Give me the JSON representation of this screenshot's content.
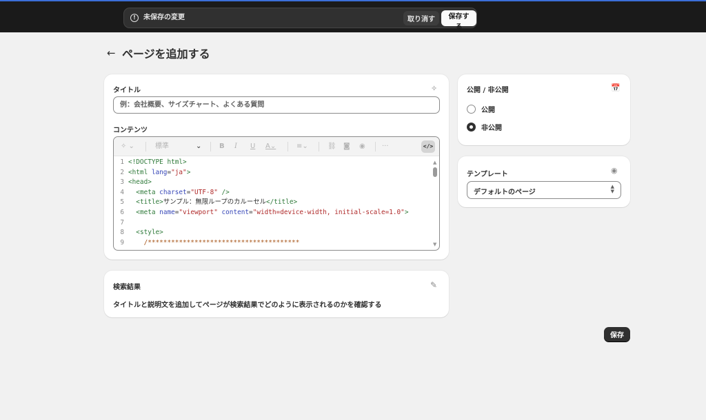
{
  "context_bar": {
    "message": "未保存の変更",
    "discard_label": "取り消す",
    "save_label": "保存する"
  },
  "header": {
    "back_icon": "←",
    "title": "ページを追加する"
  },
  "title_field": {
    "label": "タイトル",
    "placeholder": "例：会社概要、サイズチャート、よくある質問",
    "value": ""
  },
  "content": {
    "label": "コンテンツ",
    "toolbar": {
      "style_select": "標準",
      "code_toggle": "</>"
    },
    "code_lines": [
      {
        "n": "1",
        "parts": [
          {
            "c": "tag",
            "t": "<!DOCTYPE html>"
          }
        ]
      },
      {
        "n": "2",
        "parts": [
          {
            "c": "tag",
            "t": "<html "
          },
          {
            "c": "attr",
            "t": "lang"
          },
          {
            "c": "txt",
            "t": "="
          },
          {
            "c": "str",
            "t": "\"ja\""
          },
          {
            "c": "tag",
            "t": ">"
          }
        ]
      },
      {
        "n": "3",
        "parts": [
          {
            "c": "tag",
            "t": "<head>"
          }
        ]
      },
      {
        "n": "4",
        "parts": [
          {
            "c": "txt",
            "t": "  "
          },
          {
            "c": "tag",
            "t": "<meta "
          },
          {
            "c": "attr",
            "t": "charset"
          },
          {
            "c": "txt",
            "t": "="
          },
          {
            "c": "str",
            "t": "\"UTF-8\""
          },
          {
            "c": "tag",
            "t": " />"
          }
        ]
      },
      {
        "n": "5",
        "parts": [
          {
            "c": "txt",
            "t": "  "
          },
          {
            "c": "tag",
            "t": "<title>"
          },
          {
            "c": "txt",
            "t": "サンプル：無限ループのカルーセル"
          },
          {
            "c": "tag",
            "t": "</title>"
          }
        ]
      },
      {
        "n": "6",
        "parts": [
          {
            "c": "txt",
            "t": "  "
          },
          {
            "c": "tag",
            "t": "<meta "
          },
          {
            "c": "attr",
            "t": "name"
          },
          {
            "c": "txt",
            "t": "="
          },
          {
            "c": "str",
            "t": "\"viewport\""
          },
          {
            "c": "txt",
            "t": " "
          },
          {
            "c": "attr",
            "t": "content"
          },
          {
            "c": "txt",
            "t": "="
          },
          {
            "c": "str",
            "t": "\"width=device-width, initial-scale=1.0\""
          },
          {
            "c": "tag",
            "t": ">"
          }
        ]
      },
      {
        "n": "7",
        "parts": [
          {
            "c": "txt",
            "t": ""
          }
        ]
      },
      {
        "n": "8",
        "parts": [
          {
            "c": "txt",
            "t": "  "
          },
          {
            "c": "tag",
            "t": "<style>"
          }
        ]
      },
      {
        "n": "9",
        "parts": [
          {
            "c": "cmt",
            "t": "    /***************************************"
          }
        ]
      }
    ]
  },
  "seo": {
    "label": "検索結果",
    "description": "タイトルと説明文を追加してページが検索結果でどのように表示されるのかを確認する"
  },
  "visibility": {
    "label": "公開 / 非公開",
    "options": [
      {
        "label": "公開",
        "checked": false
      },
      {
        "label": "非公開",
        "checked": true
      }
    ]
  },
  "template": {
    "label": "テンプレート",
    "selected": "デフォルトのページ"
  },
  "footer": {
    "save_label": "保存"
  }
}
